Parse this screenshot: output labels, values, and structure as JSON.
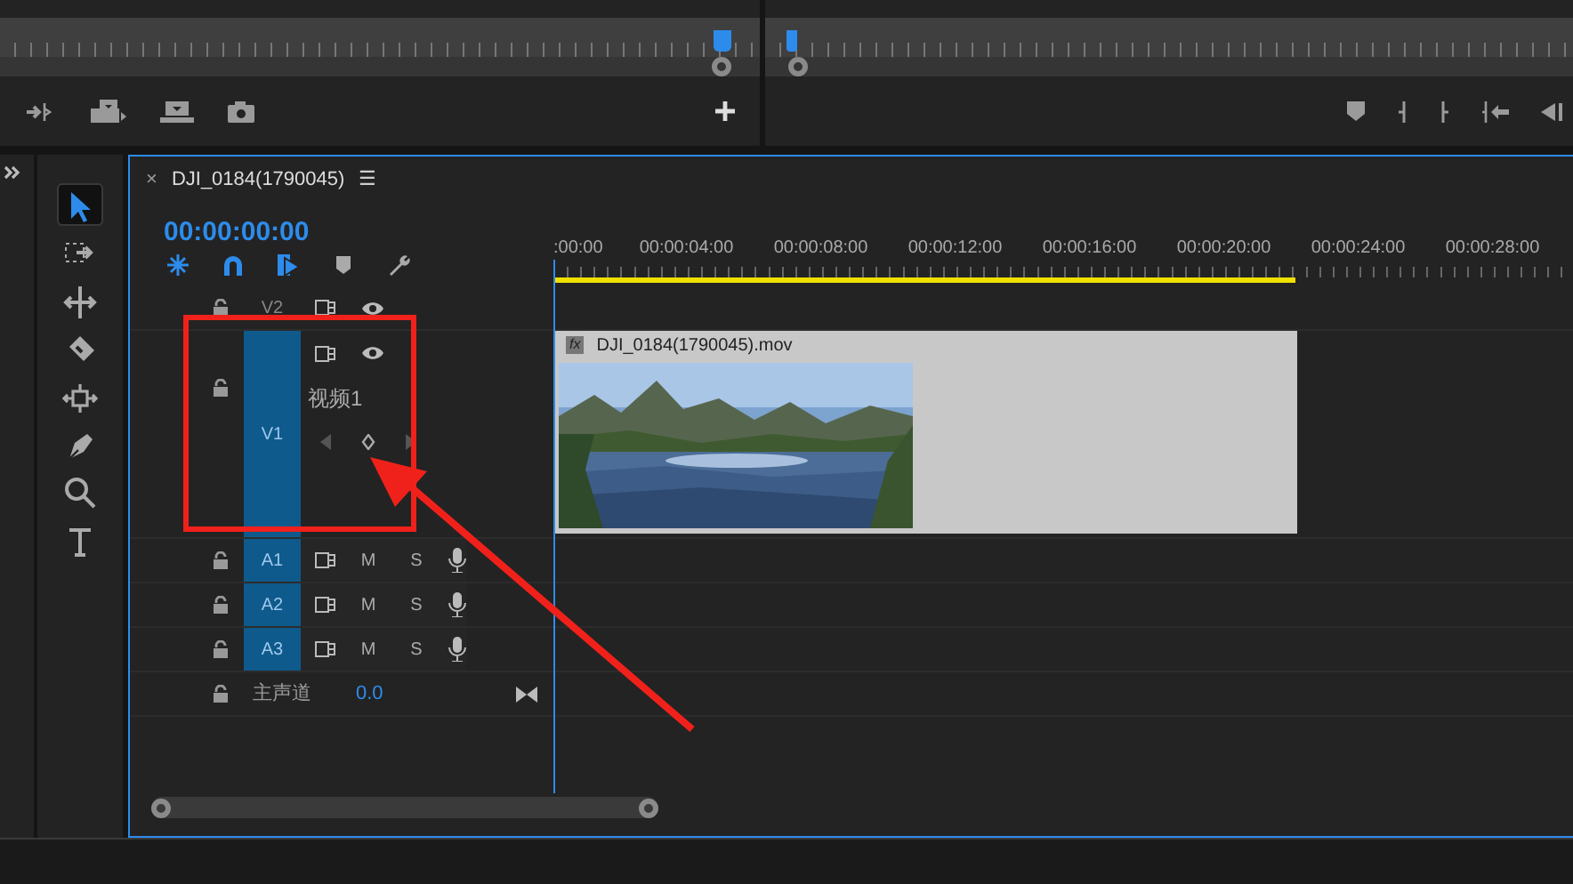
{
  "source_monitor": {
    "controls": [
      {
        "kind": "overwrite"
      },
      {
        "kind": "insert"
      },
      {
        "kind": "export"
      },
      {
        "kind": "camera"
      }
    ],
    "add": {
      "kind": "plus"
    }
  },
  "program_monitor": {
    "controls": [
      {
        "kind": "marker"
      },
      {
        "kind": "mark-in"
      },
      {
        "kind": "mark-out"
      },
      {
        "kind": "go-in"
      },
      {
        "kind": "step-back"
      }
    ]
  },
  "tools": [
    {
      "kind": "select",
      "selected": true
    },
    {
      "kind": "track-select",
      "selected": false
    },
    {
      "kind": "ripple",
      "selected": false
    },
    {
      "kind": "razor",
      "selected": false
    },
    {
      "kind": "slip",
      "selected": false
    },
    {
      "kind": "pen",
      "selected": false
    },
    {
      "kind": "zoom",
      "selected": false
    },
    {
      "kind": "type",
      "selected": false
    }
  ],
  "timeline": {
    "tab": {
      "close": "×",
      "title": "DJI_0184(1790045)",
      "menu": "☰"
    },
    "timecode": "00:00:00:00",
    "toolbar": [
      {
        "kind": "nest",
        "on": true
      },
      {
        "kind": "snap",
        "on": true
      },
      {
        "kind": "linked",
        "on": true
      },
      {
        "kind": "marker",
        "on": false
      },
      {
        "kind": "settings",
        "on": false
      }
    ],
    "ruler": [
      ":00:00",
      "00:00:04:00",
      "00:00:08:00",
      "00:00:12:00",
      "00:00:16:00",
      "00:00:20:00",
      "00:00:24:00",
      "00:00:28:00"
    ],
    "tracks": [
      {
        "kind": "video",
        "label": "V2",
        "targeted": false,
        "expanded": false
      },
      {
        "kind": "video",
        "label": "V1",
        "targeted": true,
        "expanded": true,
        "name": "视频1",
        "clip": {
          "fx": "fx",
          "name": "DJI_0184(1790045).mov"
        }
      },
      {
        "kind": "audio",
        "label": "A1",
        "targeted": true,
        "mute": "M",
        "solo": "S"
      },
      {
        "kind": "audio",
        "label": "A2",
        "targeted": true,
        "mute": "M",
        "solo": "S"
      },
      {
        "kind": "audio",
        "label": "A3",
        "targeted": true,
        "mute": "M",
        "solo": "S"
      },
      {
        "kind": "master",
        "label": "主声道",
        "value": "0.0"
      }
    ]
  },
  "annotations": {
    "highlight_frame": true,
    "arrow": true
  }
}
